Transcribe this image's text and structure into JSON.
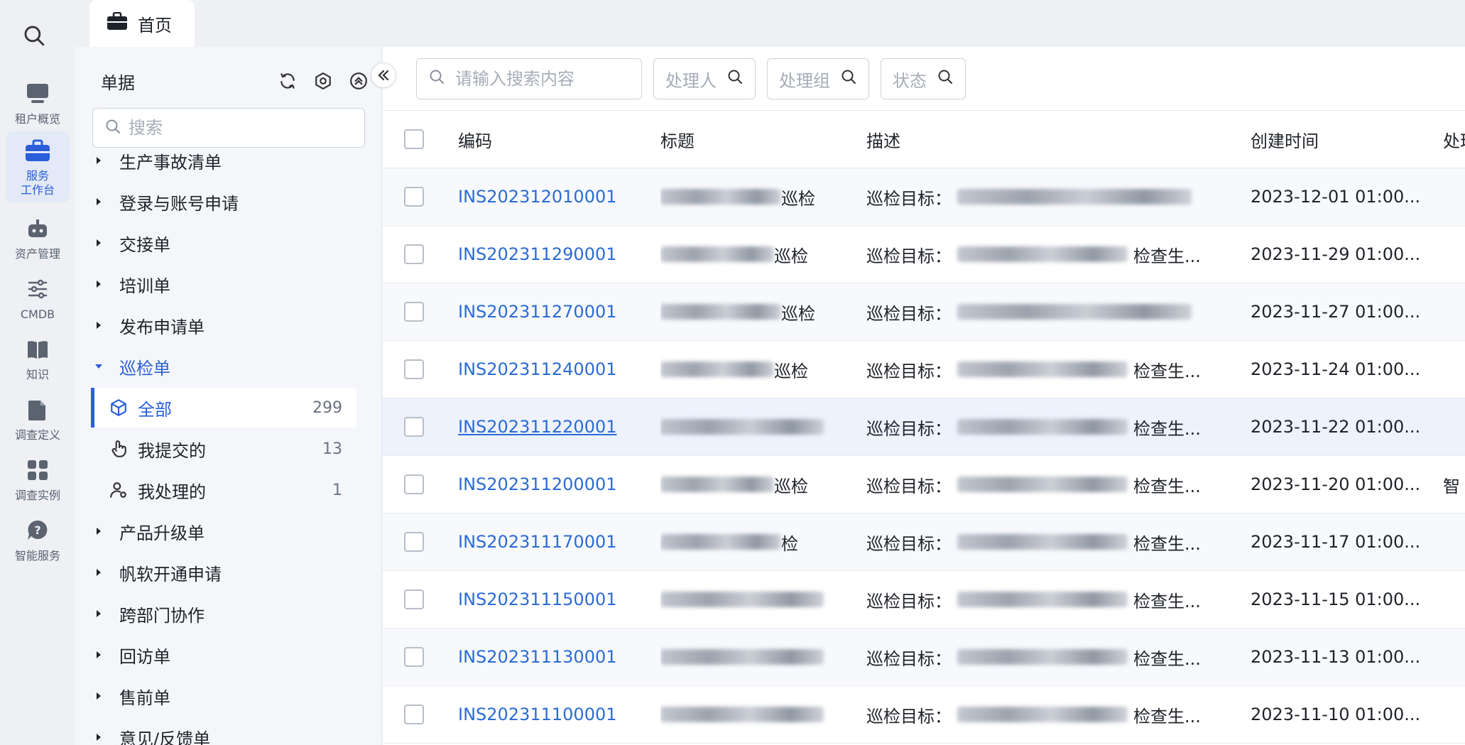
{
  "rail": {
    "items": [
      {
        "label": "租户概览",
        "icon": "monitor-icon"
      },
      {
        "label": "服务\n工作台",
        "icon": "briefcase-icon"
      },
      {
        "label": "资产管理",
        "icon": "robot-icon"
      },
      {
        "label": "CMDB",
        "icon": "sliders-icon"
      },
      {
        "label": "知识",
        "icon": "book-icon"
      },
      {
        "label": "调查定义",
        "icon": "document-icon"
      },
      {
        "label": "调查实例",
        "icon": "grid-icon"
      },
      {
        "label": "智能服务",
        "icon": "help-chat-icon"
      }
    ]
  },
  "tab": {
    "label": "首页"
  },
  "tree": {
    "title": "单据",
    "search_placeholder": "搜索",
    "nodes": [
      "生产事故清单",
      "登录与账号申请",
      "交接单",
      "培训单",
      "发布申请单",
      "巡检单",
      "产品升级单",
      "帆软开通申请",
      "跨部门协作",
      "回访单",
      "售前单",
      "意见/反馈单"
    ],
    "children": [
      {
        "label": "全部",
        "count": "299"
      },
      {
        "label": "我提交的",
        "count": "13"
      },
      {
        "label": "我处理的",
        "count": "1"
      }
    ]
  },
  "filters": {
    "search_placeholder": "请输入搜索内容",
    "assignee": "处理人",
    "group": "处理组",
    "status": "状态"
  },
  "table": {
    "headers": {
      "code": "编码",
      "title": "标题",
      "desc": "描述",
      "created": "创建时间",
      "proc": "处理"
    },
    "rows": [
      {
        "code": "INS202312010001",
        "title_suffix": "巡检",
        "desc_prefix": "巡检目标：",
        "desc_suffix": "",
        "created": "2023-12-01 01:00...",
        "proc": ""
      },
      {
        "code": "INS202311290001",
        "title_suffix": "巡检",
        "desc_prefix": "巡检目标：",
        "desc_suffix": "检查生...",
        "created": "2023-11-29 01:00...",
        "proc": ""
      },
      {
        "code": "INS202311270001",
        "title_suffix": "巡检",
        "desc_prefix": "巡检目标：",
        "desc_suffix": "",
        "created": "2023-11-27 01:00...",
        "proc": ""
      },
      {
        "code": "INS202311240001",
        "title_suffix": "巡检",
        "desc_prefix": "巡检目标：",
        "desc_suffix": "检查生...",
        "created": "2023-11-24 01:00...",
        "proc": ""
      },
      {
        "code": "INS202311220001",
        "title_suffix": "",
        "desc_prefix": "巡检目标：",
        "desc_suffix": "检查生...",
        "created": "2023-11-22 01:00...",
        "proc": ""
      },
      {
        "code": "INS202311200001",
        "title_suffix": "巡检",
        "desc_prefix": "巡检目标：",
        "desc_suffix": "检查生...",
        "created": "2023-11-20 01:00...",
        "proc": "智"
      },
      {
        "code": "INS202311170001",
        "title_suffix": "检",
        "desc_prefix": "巡检目标：",
        "desc_suffix": "检查生...",
        "created": "2023-11-17 01:00...",
        "proc": ""
      },
      {
        "code": "INS202311150001",
        "title_suffix": "",
        "desc_prefix": "巡检目标：",
        "desc_suffix": "检查生...",
        "created": "2023-11-15 01:00...",
        "proc": ""
      },
      {
        "code": "INS202311130001",
        "title_suffix": "",
        "desc_prefix": "巡检目标：",
        "desc_suffix": "检查生...",
        "created": "2023-11-13 01:00...",
        "proc": ""
      },
      {
        "code": "INS202311100001",
        "title_suffix": "",
        "desc_prefix": "巡检目标：",
        "desc_suffix": "检查生...",
        "created": "2023-11-10 01:00...",
        "proc": ""
      }
    ]
  },
  "colors": {
    "accent": "#2b5fd9",
    "link": "#2b6bd6",
    "rail_bg": "#eef0f4",
    "highlight_row": "#edf2fd"
  }
}
